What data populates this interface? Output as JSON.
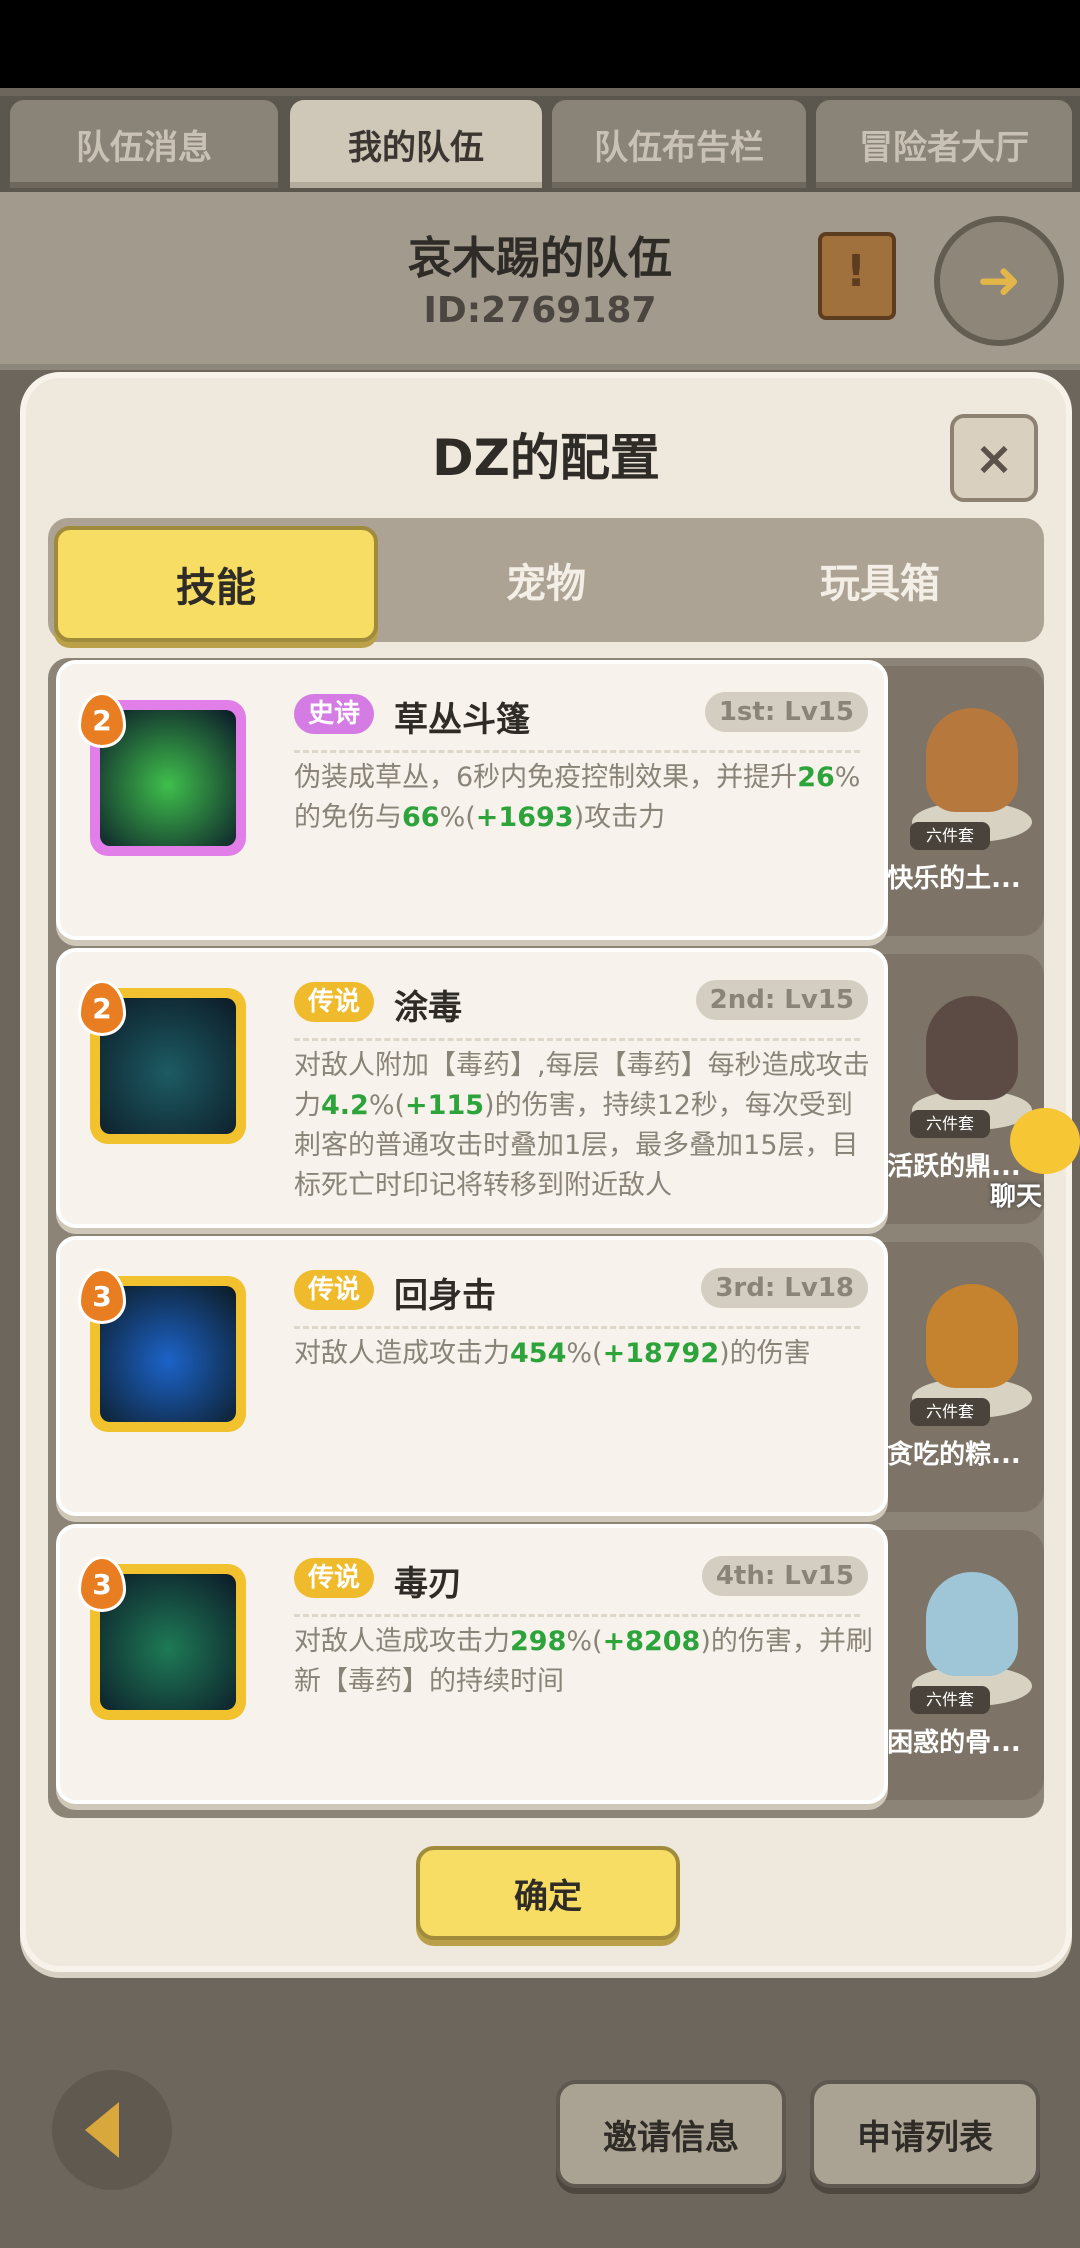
{
  "tabs": [
    {
      "label": "队伍消息"
    },
    {
      "label": "我的队伍"
    },
    {
      "label": "队伍布告栏"
    },
    {
      "label": "冒险者大厅"
    }
  ],
  "team": {
    "name": "哀木踢的队伍",
    "id": "ID:2769187"
  },
  "modal": {
    "title": "DZ的配置",
    "close": "×",
    "segments": [
      {
        "label": "技能"
      },
      {
        "label": "宠物"
      },
      {
        "label": "玩具箱"
      }
    ],
    "confirm": "确定"
  },
  "skills": [
    {
      "badge": "2",
      "rarity": "史诗",
      "rarity_color": "#d47be4",
      "name": "草丛斗篷",
      "slot": "1st: Lv15",
      "desc": [
        "伪装成草丛，6秒内免疫控制效果，并提升",
        "26",
        "%的免伤与",
        "66",
        "%(",
        "+1693",
        ")攻击力"
      ],
      "icon_color": "#3fbf4c",
      "frame_color": "#e27ee8"
    },
    {
      "badge": "2",
      "rarity": "传说",
      "rarity_color": "#efbb2c",
      "name": "涂毒",
      "slot": "2nd: Lv15",
      "desc": [
        "对敌人附加【毒药】,每层【毒药】每秒造成攻击力",
        "4.2",
        "%(",
        "+115",
        ")的伤害，持续12秒，每次受到刺客的普通攻击时叠加1层，最多叠加15层，目标死亡时印记将转移到附近敌人"
      ],
      "icon_color": "#1d5b63",
      "frame_color": "#f2c12e"
    },
    {
      "badge": "3",
      "rarity": "传说",
      "rarity_color": "#efbb2c",
      "name": "回身击",
      "slot": "3rd: Lv18",
      "desc": [
        "对敌人造成攻击力",
        "454",
        "%(",
        "+18792",
        ")的伤害"
      ],
      "icon_color": "#1c63c9",
      "frame_color": "#f2c12e"
    },
    {
      "badge": "3",
      "rarity": "传说",
      "rarity_color": "#efbb2c",
      "name": "毒刃",
      "slot": "4th: Lv15",
      "desc": [
        "对敌人造成攻击力",
        "298",
        "%(",
        "+8208",
        ")的伤害，并刷新【毒药】的持续时间"
      ],
      "icon_color": "#1e7a56",
      "frame_color": "#f2c12e"
    }
  ],
  "pets": [
    {
      "name": "快乐的土...",
      "set": "六件套",
      "color": "#b7783d"
    },
    {
      "name": "活跃的鼎...",
      "set": "六件套",
      "color": "#5c4b44"
    },
    {
      "name": "贪吃的粽...",
      "set": "六件套",
      "color": "#c5832f"
    },
    {
      "name": "困惑的骨...",
      "set": "六件套",
      "color": "#9fc6d6"
    }
  ],
  "chat": {
    "label": "聊天"
  },
  "footer": {
    "invite": "邀请信息",
    "apply": "申请列表"
  }
}
